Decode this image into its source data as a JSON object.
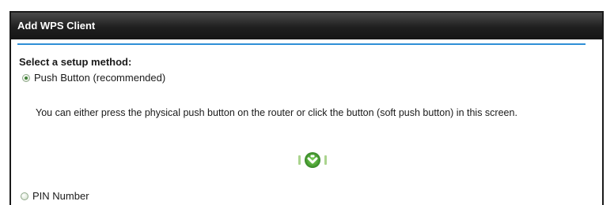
{
  "panel": {
    "title": "Add WPS Client"
  },
  "setup": {
    "heading": "Select a setup method:",
    "options": [
      {
        "label": "Push Button (recommended)",
        "selected": true
      },
      {
        "label": "PIN Number",
        "selected": false
      }
    ],
    "push_description": "You can either press the physical push button on the router or click the button (soft push button) in this screen."
  },
  "icons": {
    "push_button": "wps-push-icon"
  },
  "colors": {
    "title_bar": "#1f1f1f",
    "divider": "#2f8fd6",
    "wps_button": "#58b13a"
  }
}
